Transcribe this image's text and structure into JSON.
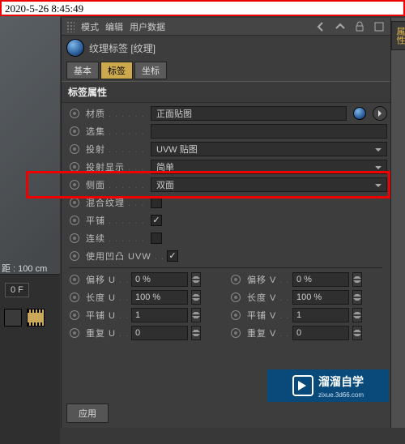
{
  "timestamp": "2020-5-26 8:45:49",
  "viewport": {
    "distance": "距 : 100 cm",
    "temp": "0 F"
  },
  "menu": {
    "mode": "模式",
    "edit": "编辑",
    "userdata": "用户数据"
  },
  "title": "纹理标签 [纹理]",
  "tabs": {
    "basic": "基本",
    "tag": "标签",
    "coord": "坐标"
  },
  "section": "标签属性",
  "props": {
    "material": {
      "label": "材质",
      "value": "正面贴图"
    },
    "selection": {
      "label": "选集"
    },
    "projection": {
      "label": "投射",
      "value": "UVW 贴图"
    },
    "projDisplay": {
      "label": "投射显示",
      "value": "简单"
    },
    "side": {
      "label": "侧面",
      "value": "双面"
    },
    "mixTex": {
      "label": "混合纹理"
    },
    "tile": {
      "label": "平铺"
    },
    "continuous": {
      "label": "连续"
    },
    "useBump": {
      "label": "使用凹凸 UVW"
    }
  },
  "uv": {
    "offsetU": {
      "label": "偏移 U",
      "value": "0 %"
    },
    "offsetV": {
      "label": "偏移 V",
      "value": "0 %"
    },
    "lengthU": {
      "label": "长度 U",
      "value": "100 %"
    },
    "lengthV": {
      "label": "长度 V",
      "value": "100 %"
    },
    "tileU": {
      "label": "平铺 U",
      "value": "1"
    },
    "tileV": {
      "label": "平铺 V",
      "value": "1"
    },
    "repeatU": {
      "label": "重复 U",
      "value": "0"
    },
    "repeatV": {
      "label": "重复 V",
      "value": "0"
    }
  },
  "apply": "应用",
  "watermark": {
    "brand": "溜溜自学",
    "url": "zixue.3d66.com"
  },
  "rightTab": "属性"
}
